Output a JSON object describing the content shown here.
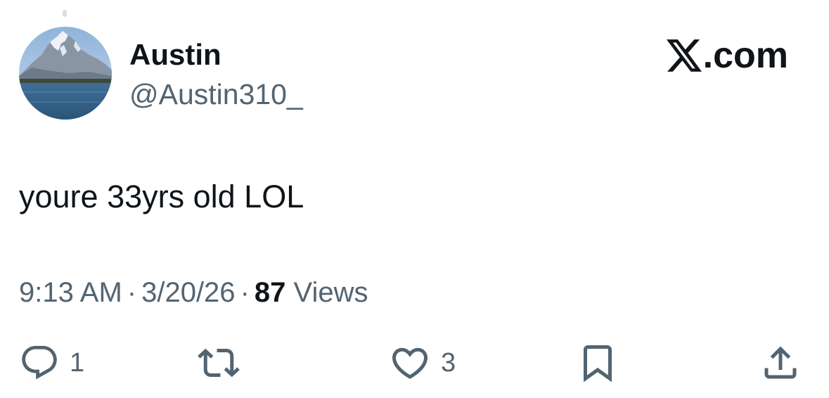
{
  "author": {
    "display_name": "Austin",
    "handle": "@Austin310_"
  },
  "brand": {
    "text": ".com",
    "icon": "x-logo-icon"
  },
  "tweet": {
    "text": "youre 33yrs old LOL"
  },
  "meta": {
    "time": "9:13 AM",
    "date": "3/20/26",
    "separator": "·",
    "views_count": "87",
    "views_label": "Views"
  },
  "actions": {
    "reply": {
      "icon": "reply-icon",
      "count": "1"
    },
    "repost": {
      "icon": "repost-icon"
    },
    "like": {
      "icon": "heart-icon",
      "count": "3"
    },
    "bookmark": {
      "icon": "bookmark-icon"
    },
    "share": {
      "icon": "share-icon"
    }
  },
  "colors": {
    "text_primary": "#0f1419",
    "text_secondary": "#536471",
    "background": "#ffffff"
  }
}
